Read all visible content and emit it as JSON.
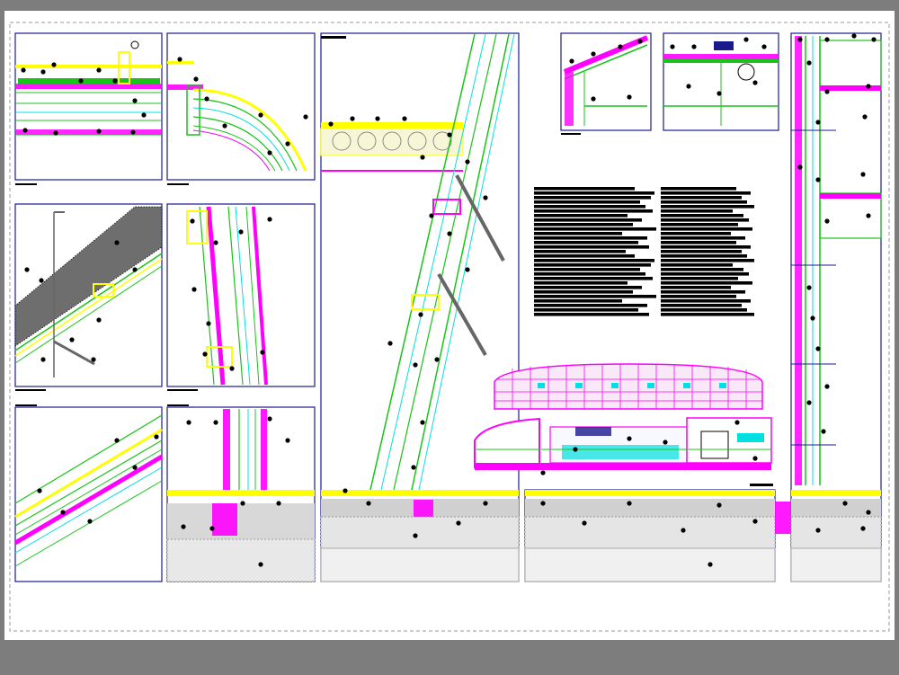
{
  "viewer": {
    "background_color": "#7d7d7d",
    "sheet_color": "#ffffff",
    "frame_color": "#1a1a8c"
  },
  "palette": {
    "green": "#19c319",
    "magenta": "#ff00ff",
    "yellow": "#ffff00",
    "cyan": "#00e0e0",
    "black": "#000000",
    "navy": "#1a1a8c",
    "grey": "#c8c8c8"
  },
  "sheet": {
    "details": [
      {
        "id": "detail-1",
        "subject": "roof-edge-section"
      },
      {
        "id": "detail-2",
        "subject": "curved-roof-junction"
      },
      {
        "id": "detail-3",
        "subject": "inclined-slab-with-bracket"
      },
      {
        "id": "detail-4",
        "subject": "inclined-glazing-mullion"
      },
      {
        "id": "detail-5",
        "subject": "inclined-roof-layers"
      },
      {
        "id": "detail-6",
        "subject": "wall-base-at-ground"
      },
      {
        "id": "detail-7",
        "subject": "inclined-facade-full-height"
      },
      {
        "id": "detail-8",
        "subject": "ridge-section"
      },
      {
        "id": "detail-9",
        "subject": "gutter-section"
      },
      {
        "id": "detail-10",
        "subject": "building-elevation"
      },
      {
        "id": "detail-11",
        "subject": "building-section"
      },
      {
        "id": "detail-12",
        "subject": "foundation-strip"
      },
      {
        "id": "detail-13",
        "subject": "vertical-wall-full-height"
      }
    ],
    "notes_blocks": [
      {
        "id": "notes-left",
        "line_count": 29
      },
      {
        "id": "notes-right",
        "line_count": 29
      }
    ]
  }
}
